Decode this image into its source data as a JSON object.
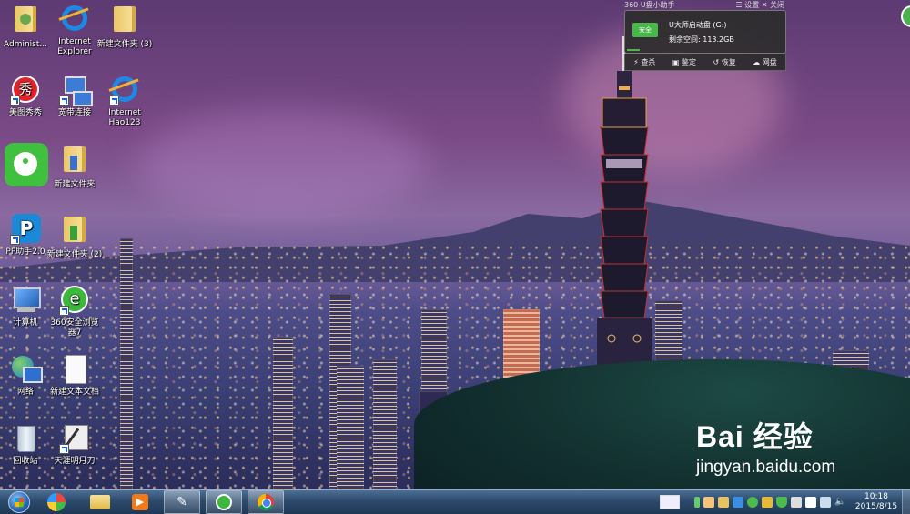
{
  "desktop": {
    "icons": [
      {
        "label": "Administ...",
        "icon": "user-folder-icon"
      },
      {
        "label": "Internet Explorer",
        "icon": "ie-icon"
      },
      {
        "label": "新建文件夹 (3)",
        "icon": "folder-icon"
      },
      {
        "label": "美图秀秀",
        "icon": "meitu-icon"
      },
      {
        "label": "宽带连接",
        "icon": "network-connection-icon"
      },
      {
        "label": "Internet Hao123",
        "icon": "ie-icon"
      },
      {
        "label": "",
        "icon": "green-chat-app-icon"
      },
      {
        "label": "新建文件夹",
        "icon": "folder-icon"
      },
      {
        "label": "PP助手2.0",
        "icon": "pp-assistant-icon"
      },
      {
        "label": "新建文件夹 (2)",
        "icon": "folder-icon"
      },
      {
        "label": "计算机",
        "icon": "computer-icon"
      },
      {
        "label": "360安全浏览器7",
        "icon": "360-browser-icon"
      },
      {
        "label": "网络",
        "icon": "network-icon"
      },
      {
        "label": "新建文本文档",
        "icon": "text-document-icon"
      },
      {
        "label": "回收站",
        "icon": "recycle-bin-icon"
      },
      {
        "label": "天涯明月刀",
        "icon": "game-icon"
      }
    ]
  },
  "udisk_helper": {
    "title": "360 U盘小助手",
    "settings_label": "设置",
    "close_label": "关闭",
    "badge": "安全",
    "drive_name": "U大师启动盘 (G:)",
    "free_space": "剩余空间: 113.2GB",
    "actions": [
      "查杀",
      "鉴定",
      "恢复",
      "网盘"
    ]
  },
  "watermark": {
    "logo": "Bai 经验",
    "url": "jingyan.baidu.com"
  },
  "taskbar": {
    "pinned": [
      "start-orb",
      "360-manager-icon",
      "explorer-icon",
      "media-player-icon",
      "pen-tool-icon",
      "360-browser-icon",
      "chrome-icon"
    ],
    "tray_icons": [
      "keyboard-icon",
      "battery-icon",
      "hand-icon",
      "folder-icon",
      "qq-icon",
      "plus-icon",
      "security-icon",
      "shield-icon",
      "clipboard-icon",
      "flag-icon",
      "monitor-icon",
      "volume-icon"
    ],
    "time": "10:18",
    "date": "2015/8/15"
  }
}
